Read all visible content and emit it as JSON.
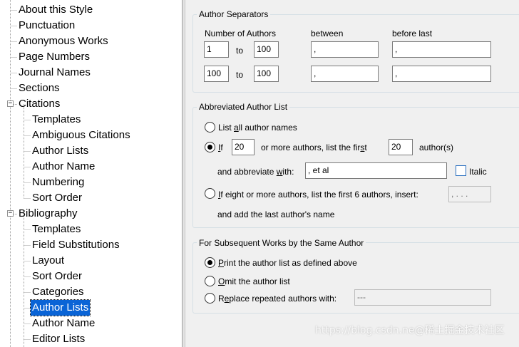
{
  "tree": {
    "items": [
      {
        "label": "About this Style"
      },
      {
        "label": "Punctuation"
      },
      {
        "label": "Anonymous Works"
      },
      {
        "label": "Page Numbers"
      },
      {
        "label": "Journal Names"
      },
      {
        "label": "Sections"
      },
      {
        "label": "Citations"
      },
      {
        "label": "Templates"
      },
      {
        "label": "Ambiguous Citations"
      },
      {
        "label": "Author Lists"
      },
      {
        "label": "Author Name"
      },
      {
        "label": "Numbering"
      },
      {
        "label": "Sort Order"
      },
      {
        "label": "Bibliography"
      },
      {
        "label": "Templates"
      },
      {
        "label": "Field Substitutions"
      },
      {
        "label": "Layout"
      },
      {
        "label": "Sort Order"
      },
      {
        "label": "Categories"
      },
      {
        "label": "Author Lists"
      },
      {
        "label": "Author Name"
      },
      {
        "label": "Editor Lists"
      }
    ],
    "toggle_symbol": "−",
    "selected_item": "Author Lists"
  },
  "separators": {
    "title": "Author Separators",
    "number_of_authors_label": "Number of Authors",
    "between_label": "between",
    "before_last_label": "before last",
    "to_label": "to",
    "rows": [
      {
        "from": "1",
        "to": "100",
        "between": ",",
        "before_last": ","
      },
      {
        "from": "100",
        "to": "100",
        "between": ",",
        "before_last": ","
      }
    ]
  },
  "abbreviated": {
    "title": "Abbreviated Author List",
    "list_all_pre": "List ",
    "list_all_key": "a",
    "list_all_post": "ll author names",
    "if_key": "I",
    "if_post": "f",
    "if_value": "20",
    "or_more_pre": "or more authors, list the fir",
    "or_more_key": "s",
    "or_more_post": "t",
    "first_value": "20",
    "authors_suffix": "author(s)",
    "abbrev_pre": "and abbreviate ",
    "abbrev_key": "w",
    "abbrev_post": "ith:",
    "abbrev_value": ", et al",
    "italic_label": "Italic",
    "italic_checked": false,
    "eight_key": "I",
    "eight_post": "f eight or more authors, list the first 6 authors, insert:",
    "eight_value": ", . . .",
    "add_last": "and add the last author's name",
    "selected": "if"
  },
  "subsequent": {
    "title": "For Subsequent Works by the Same Author",
    "print_key": "P",
    "print_post": "rint the author list as defined above",
    "omit_key": "O",
    "omit_post": "mit the author list",
    "replace_pre": "R",
    "replace_key": "e",
    "replace_post": "place repeated authors with:",
    "replace_value": "---",
    "selected": "print"
  },
  "watermark": "https://blog.csdn.ne@稀土掘金技术社区"
}
